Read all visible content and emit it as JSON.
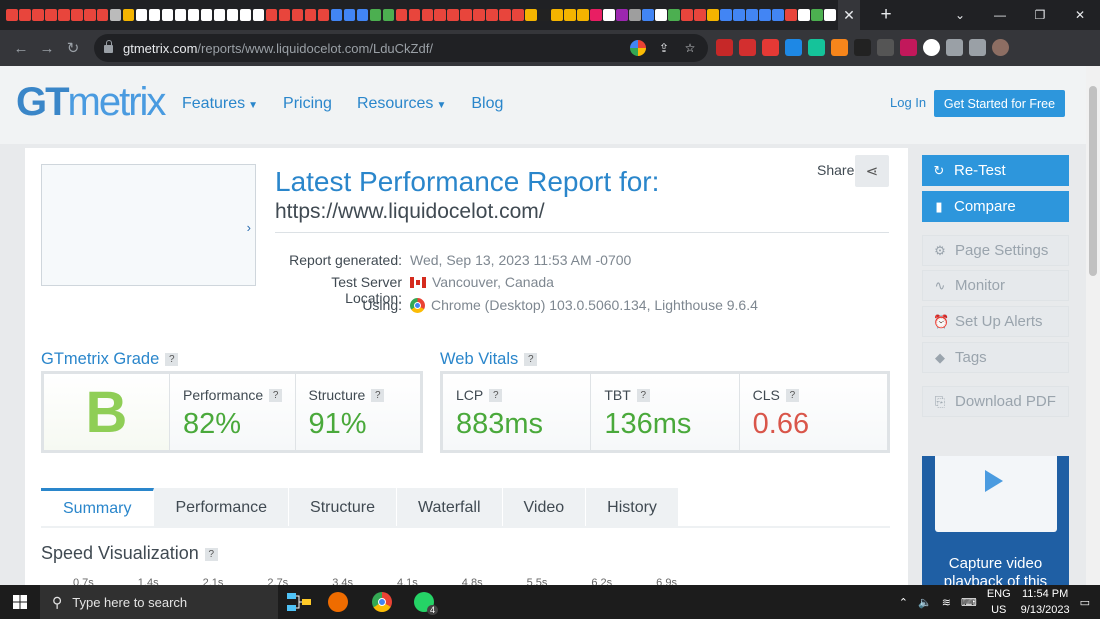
{
  "browser": {
    "url_domain": "gtmetrix.com",
    "url_path": "/reports/www.liquidocelot.com/LduCkZdf/",
    "active_tab_close": "✕",
    "new_tab": "+",
    "minimize": "—",
    "maximize": "❐",
    "close": "✕",
    "mini_tab_colors": [
      "#e8453c",
      "#e8453c",
      "#e8453c",
      "#e8453c",
      "#e8453c",
      "#e8453c",
      "#e8453c",
      "#e8453c",
      "#bbbbbb",
      "#f4b400",
      "#ffffff",
      "#ffffff",
      "#ffffff",
      "#ffffff",
      "#ffffff",
      "#ffffff",
      "#ffffff",
      "#ffffff",
      "#ffffff",
      "#ffffff",
      "#e8453c",
      "#e8453c",
      "#e8453c",
      "#e8453c",
      "#e8453c",
      "#4285f4",
      "#4285f4",
      "#4285f4",
      "#4caf50",
      "#4caf50",
      "#e8453c",
      "#e8453c",
      "#e8453c",
      "#e8453c",
      "#e8453c",
      "#e8453c",
      "#e8453c",
      "#e8453c",
      "#e8453c",
      "#e8453c",
      "#f4b400",
      "#222222",
      "#f4b400",
      "#f4b400",
      "#f4b400",
      "#e91e63",
      "#ffffff",
      "#9c27b0",
      "#9e9e9e",
      "#4285f4",
      "#ffffff",
      "#4caf50",
      "#e8453c",
      "#e8453c",
      "#f4b400",
      "#4285f4",
      "#4285f4",
      "#4285f4",
      "#4285f4",
      "#4285f4",
      "#e8453c",
      "#ffffff",
      "#4caf50",
      "#ffffff"
    ]
  },
  "extensions": [
    {
      "name": "adblock-icon",
      "color": "#c62828"
    },
    {
      "name": "red-extension-icon",
      "color": "#d32f2f"
    },
    {
      "name": "pdf-extension-icon",
      "color": "#e53935"
    },
    {
      "name": "translate-extension-icon",
      "color": "#1e88e5"
    },
    {
      "name": "grammarly-icon",
      "color": "#15c39a"
    },
    {
      "name": "metamask-icon",
      "color": "#f6851b"
    },
    {
      "name": "rabbit-extension-icon",
      "color": "#222222"
    },
    {
      "name": "bitwarden-extension-icon",
      "color": "#555555"
    },
    {
      "name": "key-extension-icon",
      "color": "#c2185b"
    },
    {
      "name": "octocat-extension-icon",
      "color": "#ffffff"
    },
    {
      "name": "puzzle-icon",
      "color": "#9aa0a6"
    },
    {
      "name": "sidepanel-icon",
      "color": "#9aa0a6"
    },
    {
      "name": "profile-avatar",
      "color": "#8d6e63"
    }
  ],
  "header": {
    "logo_bold": "GT",
    "logo_light": "metrix",
    "nav": [
      {
        "label": "Features",
        "dropdown": true
      },
      {
        "label": "Pricing",
        "dropdown": false
      },
      {
        "label": "Resources",
        "dropdown": true
      },
      {
        "label": "Blog",
        "dropdown": false
      }
    ],
    "login": "Log In",
    "get_started": "Get Started for Free"
  },
  "report": {
    "title": "Latest Performance Report for:",
    "url": "https://www.liquidocelot.com/",
    "share_label": "Share",
    "generated_label": "Report generated:",
    "generated_value": "Wed, Sep 13, 2023 11:53 AM -0700",
    "location_label": "Test Server Location:",
    "location_value": "Vancouver, Canada",
    "using_label": "Using:",
    "using_value": "Chrome (Desktop) 103.0.5060.134, Lighthouse 9.6.4"
  },
  "grade": {
    "section_title": "GTmetrix Grade",
    "help": "?",
    "letter": "B",
    "performance_label": "Performance",
    "performance_value": "82%",
    "structure_label": "Structure",
    "structure_value": "91%"
  },
  "vitals": {
    "section_title": "Web Vitals",
    "lcp_label": "LCP",
    "lcp_value": "883ms",
    "tbt_label": "TBT",
    "tbt_value": "136ms",
    "cls_label": "CLS",
    "cls_value": "0.66"
  },
  "tabs": [
    "Summary",
    "Performance",
    "Structure",
    "Waterfall",
    "Video",
    "History"
  ],
  "speed": {
    "title": "Speed Visualization",
    "timeline": [
      "0.7s",
      "1.4s",
      "2.1s",
      "2.7s",
      "3.4s",
      "4.1s",
      "4.8s",
      "5.5s",
      "6.2s",
      "6.9s"
    ]
  },
  "sidebar": {
    "retest": "Re-Test",
    "compare": "Compare",
    "page_settings": "Page Settings",
    "monitor": "Monitor",
    "alerts": "Set Up Alerts",
    "tags": "Tags",
    "download_pdf": "Download PDF",
    "ad_text": "Capture video playback of this"
  },
  "taskbar": {
    "search_placeholder": "Type here to search",
    "whatsapp_badge": "4",
    "lang_line1": "ENG",
    "lang_line2": "US",
    "time": "11:54 PM",
    "date": "9/13/2023"
  }
}
